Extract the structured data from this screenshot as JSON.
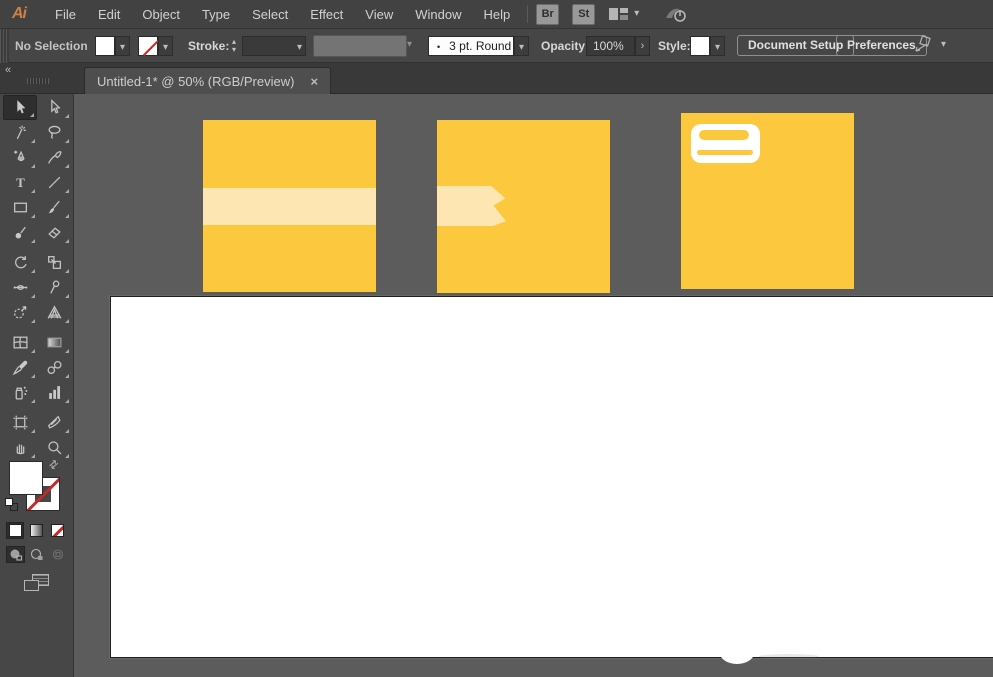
{
  "menu_bar": {
    "logo": "Ai",
    "items": [
      "File",
      "Edit",
      "Object",
      "Type",
      "Select",
      "Effect",
      "View",
      "Window",
      "Help"
    ],
    "bridge_button": "Br",
    "style_button": "St",
    "workspace_chevron": "▾",
    "icons": [
      "workspace-switcher-icon",
      "cs-live-icon"
    ]
  },
  "control_bar": {
    "selection_status": "No Selection",
    "stroke_label": "Stroke:",
    "stepper_up": "▴",
    "stepper_down": "▾",
    "chevron": "▾",
    "brush_bullet": "•",
    "brush_preset": "3 pt. Round",
    "opacity_label": "Opacity:",
    "opacity_value": "100%",
    "opacity_expand": "›",
    "style_label": "Style:",
    "document_setup_button": "Document Setup",
    "preferences_button": "Preferences"
  },
  "tab_bar": {
    "collapse_glyph": "«",
    "document_tab": {
      "title": "Untitled-1* @ 50% (RGB/Preview)",
      "close_glyph": "×"
    }
  },
  "toolbar": {
    "selected_tool": "selection",
    "tools": [
      "selection",
      "direct-selection",
      "magic-wand",
      "lasso",
      "pen",
      "pencil",
      "type",
      "line-segment",
      "rectangle",
      "paintbrush",
      "blob-brush",
      "eraser",
      "rotate",
      "scale",
      "width",
      "free-transform",
      "shape-builder",
      "perspective-grid",
      "mesh",
      "gradient",
      "eyedropper",
      "blend",
      "symbol-sprayer",
      "column-graph",
      "artboard",
      "slice",
      "hand",
      "zoom"
    ],
    "fill_color": "#ffffff",
    "stroke_color": "none",
    "swap_glyph": "⇄"
  },
  "canvas": {
    "colors": {
      "pasteboard": "#5d5c5c",
      "card_yellow": "#fcc83e",
      "accent_cream": "#fde6b1",
      "badge_white": "#ffffff"
    },
    "artboard_background": "#ffffff",
    "cards": [
      {
        "name": "card-stripe",
        "decoration": "full-width cream stripe"
      },
      {
        "name": "card-ribbon",
        "decoration": "cream ribbon with zigzag end"
      },
      {
        "name": "card-badge",
        "decoration": "white rounded badge with two slots"
      }
    ]
  }
}
